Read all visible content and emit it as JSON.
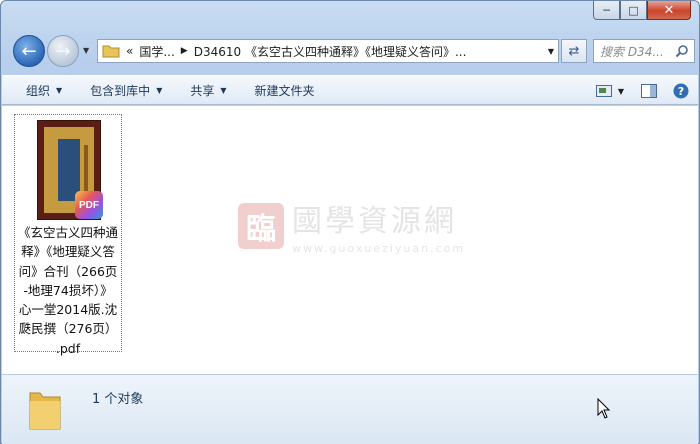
{
  "window": {
    "caption": {
      "minimize_glyph": "─",
      "maximize_glyph": "□",
      "close_glyph": "✕"
    }
  },
  "address_bar": {
    "overflow_glyph": "«",
    "crumbs": [
      "国学...",
      "D34610 《玄空古义四种通释》《地理疑义答问》..."
    ],
    "icon": "folder-icon"
  },
  "search": {
    "placeholder": "搜索 D34..."
  },
  "toolbar": {
    "organize": "组织",
    "include_in_library": "包含到库中",
    "share": "共享",
    "new_folder": "新建文件夹"
  },
  "file": {
    "name": "《玄空古义四种通释》《地理疑义答问》合刊（266页-地理74损坏）》心一堂2014版.沈瓞民撰（276页）.pdf",
    "name_lines": [
      "《玄空古义四种通",
      "释》《地理疑义答",
      "问》合刊（266页",
      "-地理74损坏）》",
      "心一堂2014版.沈",
      "瓞民撰（276页）",
      ".pdf"
    ],
    "badge": "PDF"
  },
  "watermark": {
    "logo_char": "臨",
    "text": "國學資源網",
    "url": "www.guoxueziyuan.com"
  },
  "status": {
    "count_text": "1 个对象"
  }
}
